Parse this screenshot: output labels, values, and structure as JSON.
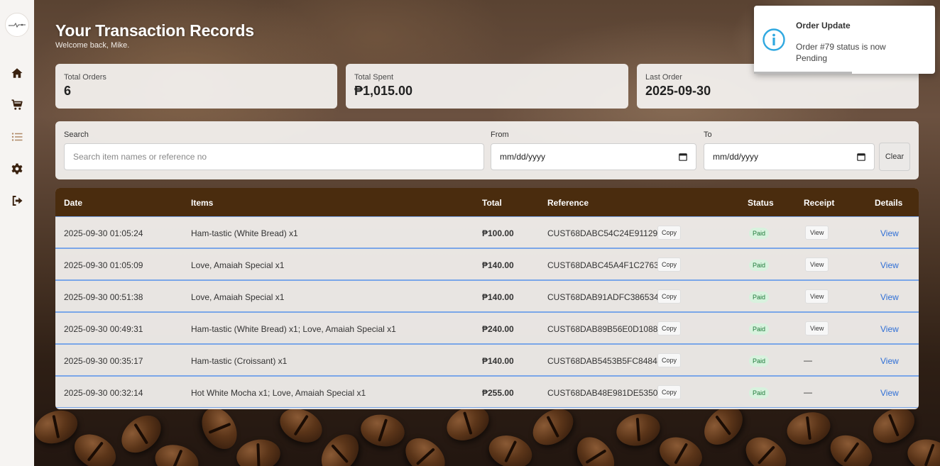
{
  "sidebar": {
    "items": [
      {
        "icon": "home-icon"
      },
      {
        "icon": "cart-icon"
      },
      {
        "icon": "list-icon",
        "active": true
      },
      {
        "icon": "gear-icon"
      },
      {
        "icon": "logout-icon"
      }
    ]
  },
  "header": {
    "title": "Your Transaction Records",
    "welcome": "Welcome back, Mike."
  },
  "stats": {
    "total_orders_label": "Total Orders",
    "total_orders_value": "6",
    "total_spent_label": "Total Spent",
    "total_spent_value": "₱1,015.00",
    "last_order_label": "Last Order",
    "last_order_value": "2025-09-30"
  },
  "filters": {
    "search_label": "Search",
    "search_placeholder": "Search item names or reference no",
    "from_label": "From",
    "from_value": "mm/dd/yyyy",
    "to_label": "To",
    "to_value": "mm/dd/yyyy",
    "clear_label": "Clear"
  },
  "table": {
    "headers": {
      "date": "Date",
      "items": "Items",
      "total": "Total",
      "reference": "Reference",
      "status": "Status",
      "receipt": "Receipt",
      "details": "Details"
    },
    "copy_label": "Copy",
    "details_label": "View",
    "rows": [
      {
        "date": "2025-09-30 01:05:24",
        "items": "Ham-tastic (White Bread) x1",
        "total": "₱100.00",
        "reference": "CUST68DABC54C24E91129",
        "status": "Paid",
        "receipt": "View"
      },
      {
        "date": "2025-09-30 01:05:09",
        "items": "Love, Amaiah Special x1",
        "total": "₱140.00",
        "reference": "CUST68DABC45A4F1C2763",
        "status": "Paid",
        "receipt": "View"
      },
      {
        "date": "2025-09-30 00:51:38",
        "items": "Love, Amaiah Special x1",
        "total": "₱140.00",
        "reference": "CUST68DAB91ADFC386534",
        "status": "Paid",
        "receipt": "View"
      },
      {
        "date": "2025-09-30 00:49:31",
        "items": "Ham-tastic (White Bread) x1; Love, Amaiah Special x1",
        "total": "₱240.00",
        "reference": "CUST68DAB89B56E0D1088",
        "status": "Paid",
        "receipt": "View"
      },
      {
        "date": "2025-09-30 00:35:17",
        "items": "Ham-tastic (Croissant) x1",
        "total": "₱140.00",
        "reference": "CUST68DAB5453B5FC8484",
        "status": "Paid",
        "receipt": "—"
      },
      {
        "date": "2025-09-30 00:32:14",
        "items": "Hot White Mocha x1; Love, Amaiah Special x1",
        "total": "₱255.00",
        "reference": "CUST68DAB48E981DE5350",
        "status": "Paid",
        "receipt": "—"
      }
    ]
  },
  "toast": {
    "title": "Order Update",
    "message": "Order #79 status is now Pending",
    "progress": 0.54
  },
  "colors": {
    "table_header": "#4a2c0e",
    "accent_icon": "#3a2210",
    "active_icon": "#b08a68",
    "status_paid_bg": "#d8f2de",
    "status_paid_text": "#1f7a3a",
    "link": "#2f6fd6",
    "toast_icon": "#2fa8e0"
  }
}
